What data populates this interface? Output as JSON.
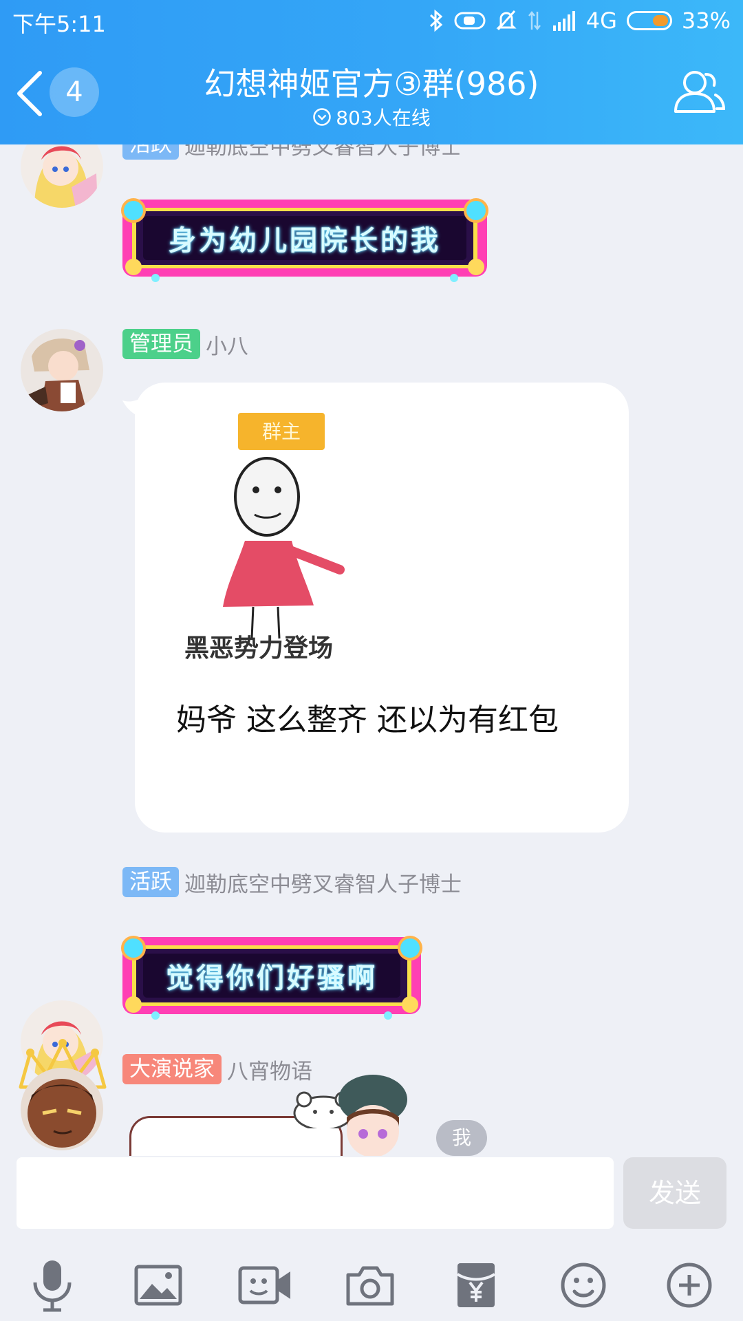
{
  "status_bar": {
    "time": "下午5:11",
    "network": "4G",
    "battery": "33%"
  },
  "header": {
    "unread_count": "4",
    "title": "幻想神姬官方③群(986)",
    "online": "803人在线"
  },
  "messages": [
    {
      "tag": "活跃",
      "nickname": "迦勒底空中劈叉睿智人子博士",
      "text": "身为幼儿园院长的我"
    },
    {
      "tag": "管理员",
      "nickname": "小八",
      "sticker_top_label": "群主",
      "sticker_caption": "黑恶势力登场",
      "text": "妈爷 这么整齐 还以为有红包"
    },
    {
      "tag": "活跃",
      "nickname": "迦勒底空中劈叉睿智人子博士",
      "text": "觉得你们好骚啊"
    },
    {
      "tag": "大演说家",
      "nickname": "八宵物语",
      "badge": "我"
    }
  ],
  "input": {
    "placeholder": "",
    "send_label": "发送"
  },
  "toolbar": [
    "mic-icon",
    "image-icon",
    "video-call-icon",
    "camera-icon",
    "red-packet-icon",
    "emoji-icon",
    "plus-icon"
  ],
  "colors": {
    "header_start": "#2f9bf5",
    "header_end": "#3cb8f9",
    "tag_active": "#7cb8f6",
    "tag_admin": "#4cd08a",
    "tag_speaker": "#f7877a",
    "chat_bg": "#eef0f6"
  }
}
